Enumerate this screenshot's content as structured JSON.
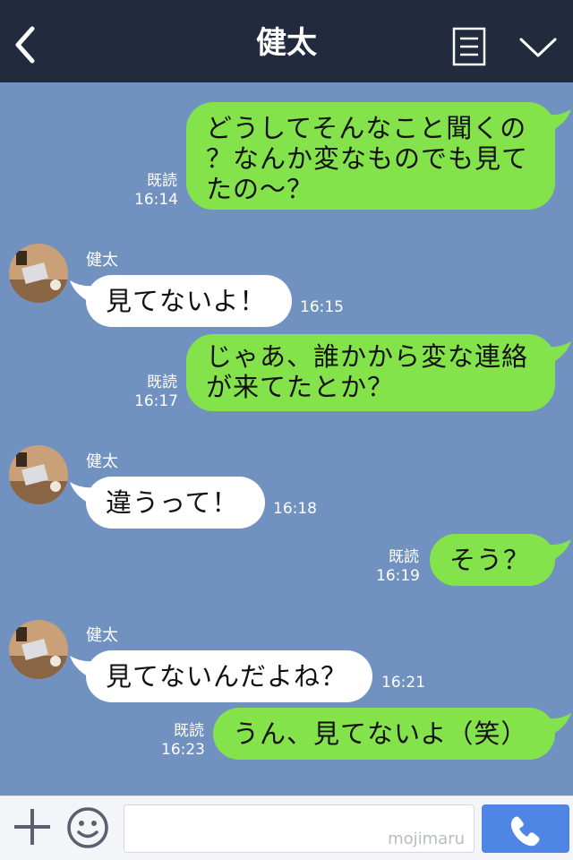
{
  "header": {
    "title": "健太",
    "back_icon": "chevron-left-icon",
    "menu_icon": "document-lines-icon",
    "dropdown_icon": "chevron-down-icon"
  },
  "messages": [
    {
      "sender": "me",
      "text": "どうしてそんなこと聞くの\n？なんか変なものでも見て\nたの〜？",
      "read": "既読",
      "time": "16:14"
    },
    {
      "sender": "them",
      "name": "健太",
      "text": "見てないよ！",
      "time": "16:15"
    },
    {
      "sender": "me",
      "text": "じゃあ、誰かから変な連絡\nが来てたとか？",
      "read": "既読",
      "time": "16:17"
    },
    {
      "sender": "them",
      "name": "健太",
      "text": "違うって！",
      "time": "16:18"
    },
    {
      "sender": "me",
      "text": "そう？",
      "read": "既読",
      "time": "16:19"
    },
    {
      "sender": "them",
      "name": "健太",
      "text": "見てないんだよね？",
      "time": "16:21"
    },
    {
      "sender": "me",
      "text": "うん、見てないよ（笑）",
      "read": "既読",
      "time": "16:23"
    }
  ],
  "input_bar": {
    "plus_icon": "plus-icon",
    "emoji_icon": "smiley-icon",
    "watermark": "mojimaru",
    "call_icon": "phone-icon"
  },
  "colors": {
    "header": "#222b3e",
    "background": "#7191c1",
    "my_bubble": "#84e34a",
    "their_bubble": "#ffffff",
    "call_button": "#4f86e6"
  }
}
